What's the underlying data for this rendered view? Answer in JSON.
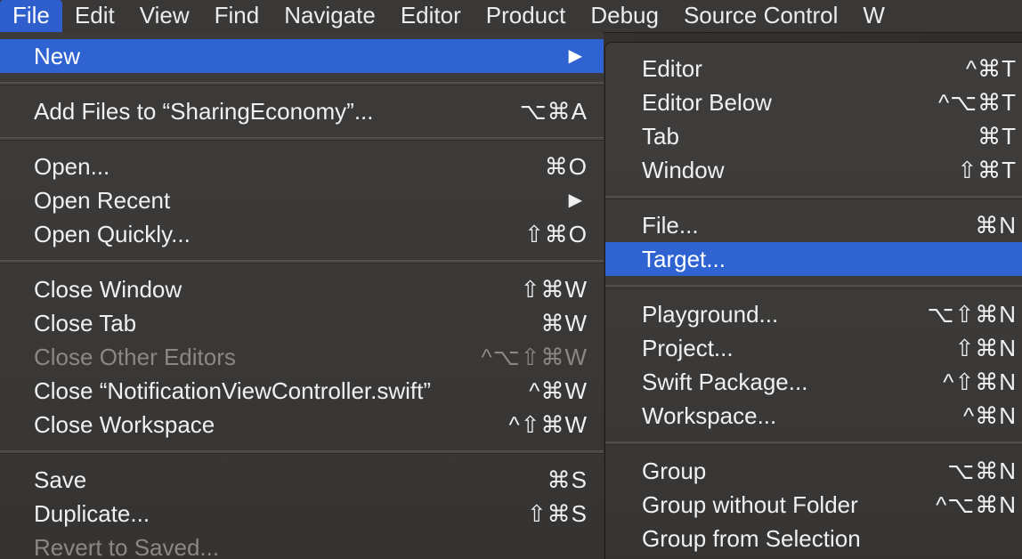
{
  "menubar": {
    "items": [
      "File",
      "Edit",
      "View",
      "Find",
      "Navigate",
      "Editor",
      "Product",
      "Debug",
      "Source Control",
      "W"
    ]
  },
  "file_menu": {
    "new": {
      "label": "New",
      "arrow": "▶"
    },
    "add_files": {
      "label": "Add Files to “SharingEconomy”...",
      "shortcut": "⌥⌘A"
    },
    "open": {
      "label": "Open...",
      "shortcut": "⌘O"
    },
    "open_recent": {
      "label": "Open Recent",
      "arrow": "▶"
    },
    "open_quickly": {
      "label": "Open Quickly...",
      "shortcut": "⇧⌘O"
    },
    "close_window": {
      "label": "Close Window",
      "shortcut": "⇧⌘W"
    },
    "close_tab": {
      "label": "Close Tab",
      "shortcut": "⌘W"
    },
    "close_other_editors": {
      "label": "Close Other Editors",
      "shortcut": "^⌥⇧⌘W"
    },
    "close_file": {
      "label": "Close “NotificationViewController.swift”",
      "shortcut": "^⌘W"
    },
    "close_workspace": {
      "label": "Close Workspace",
      "shortcut": "^⇧⌘W"
    },
    "save": {
      "label": "Save",
      "shortcut": "⌘S"
    },
    "duplicate": {
      "label": "Duplicate...",
      "shortcut": "⇧⌘S"
    },
    "revert": {
      "label": "Revert to Saved..."
    }
  },
  "new_submenu": {
    "editor": {
      "label": "Editor",
      "shortcut": "^⌘T"
    },
    "editor_below": {
      "label": "Editor Below",
      "shortcut": "^⌥⌘T"
    },
    "tab": {
      "label": "Tab",
      "shortcut": "⌘T"
    },
    "window": {
      "label": "Window",
      "shortcut": "⇧⌘T"
    },
    "file": {
      "label": "File...",
      "shortcut": "⌘N"
    },
    "target": {
      "label": "Target..."
    },
    "playground": {
      "label": "Playground...",
      "shortcut": "⌥⇧⌘N"
    },
    "project": {
      "label": "Project...",
      "shortcut": "⇧⌘N"
    },
    "swift_package": {
      "label": "Swift Package...",
      "shortcut": "^⇧⌘N"
    },
    "workspace": {
      "label": "Workspace...",
      "shortcut": "^⌘N"
    },
    "group": {
      "label": "Group",
      "shortcut": "⌥⌘N"
    },
    "group_without_folder": {
      "label": "Group without Folder",
      "shortcut": "^⌥⌘N"
    },
    "group_from_selection": {
      "label": "Group from Selection"
    }
  },
  "colors": {
    "highlight": "#2e63d1",
    "menu_background": "#3b3937",
    "disabled_text": "#8a8886"
  }
}
